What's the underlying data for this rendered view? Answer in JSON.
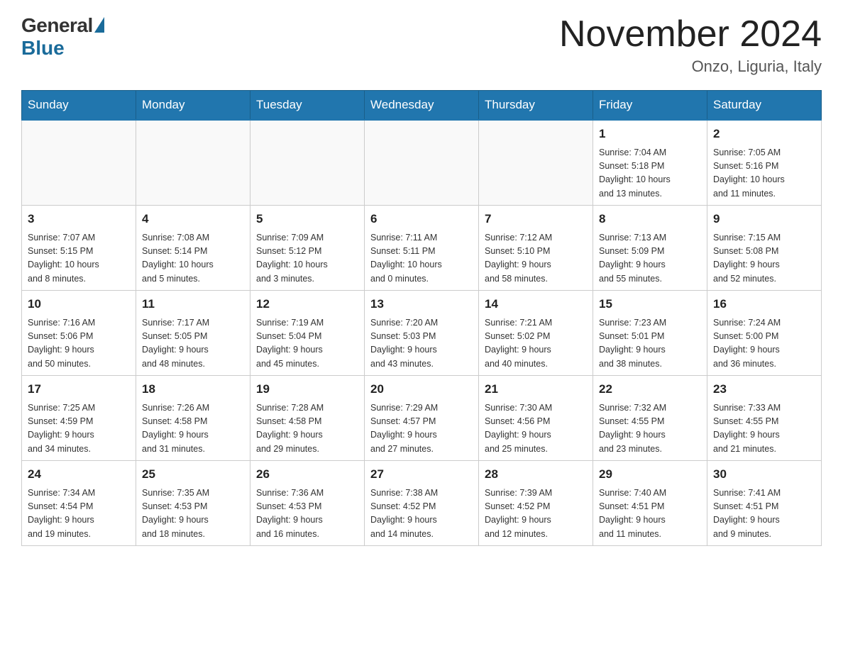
{
  "logo": {
    "general": "General",
    "blue": "Blue"
  },
  "header": {
    "title": "November 2024",
    "location": "Onzo, Liguria, Italy"
  },
  "days_of_week": [
    "Sunday",
    "Monday",
    "Tuesday",
    "Wednesday",
    "Thursday",
    "Friday",
    "Saturday"
  ],
  "weeks": [
    [
      {
        "day": "",
        "info": ""
      },
      {
        "day": "",
        "info": ""
      },
      {
        "day": "",
        "info": ""
      },
      {
        "day": "",
        "info": ""
      },
      {
        "day": "",
        "info": ""
      },
      {
        "day": "1",
        "info": "Sunrise: 7:04 AM\nSunset: 5:18 PM\nDaylight: 10 hours\nand 13 minutes."
      },
      {
        "day": "2",
        "info": "Sunrise: 7:05 AM\nSunset: 5:16 PM\nDaylight: 10 hours\nand 11 minutes."
      }
    ],
    [
      {
        "day": "3",
        "info": "Sunrise: 7:07 AM\nSunset: 5:15 PM\nDaylight: 10 hours\nand 8 minutes."
      },
      {
        "day": "4",
        "info": "Sunrise: 7:08 AM\nSunset: 5:14 PM\nDaylight: 10 hours\nand 5 minutes."
      },
      {
        "day": "5",
        "info": "Sunrise: 7:09 AM\nSunset: 5:12 PM\nDaylight: 10 hours\nand 3 minutes."
      },
      {
        "day": "6",
        "info": "Sunrise: 7:11 AM\nSunset: 5:11 PM\nDaylight: 10 hours\nand 0 minutes."
      },
      {
        "day": "7",
        "info": "Sunrise: 7:12 AM\nSunset: 5:10 PM\nDaylight: 9 hours\nand 58 minutes."
      },
      {
        "day": "8",
        "info": "Sunrise: 7:13 AM\nSunset: 5:09 PM\nDaylight: 9 hours\nand 55 minutes."
      },
      {
        "day": "9",
        "info": "Sunrise: 7:15 AM\nSunset: 5:08 PM\nDaylight: 9 hours\nand 52 minutes."
      }
    ],
    [
      {
        "day": "10",
        "info": "Sunrise: 7:16 AM\nSunset: 5:06 PM\nDaylight: 9 hours\nand 50 minutes."
      },
      {
        "day": "11",
        "info": "Sunrise: 7:17 AM\nSunset: 5:05 PM\nDaylight: 9 hours\nand 48 minutes."
      },
      {
        "day": "12",
        "info": "Sunrise: 7:19 AM\nSunset: 5:04 PM\nDaylight: 9 hours\nand 45 minutes."
      },
      {
        "day": "13",
        "info": "Sunrise: 7:20 AM\nSunset: 5:03 PM\nDaylight: 9 hours\nand 43 minutes."
      },
      {
        "day": "14",
        "info": "Sunrise: 7:21 AM\nSunset: 5:02 PM\nDaylight: 9 hours\nand 40 minutes."
      },
      {
        "day": "15",
        "info": "Sunrise: 7:23 AM\nSunset: 5:01 PM\nDaylight: 9 hours\nand 38 minutes."
      },
      {
        "day": "16",
        "info": "Sunrise: 7:24 AM\nSunset: 5:00 PM\nDaylight: 9 hours\nand 36 minutes."
      }
    ],
    [
      {
        "day": "17",
        "info": "Sunrise: 7:25 AM\nSunset: 4:59 PM\nDaylight: 9 hours\nand 34 minutes."
      },
      {
        "day": "18",
        "info": "Sunrise: 7:26 AM\nSunset: 4:58 PM\nDaylight: 9 hours\nand 31 minutes."
      },
      {
        "day": "19",
        "info": "Sunrise: 7:28 AM\nSunset: 4:58 PM\nDaylight: 9 hours\nand 29 minutes."
      },
      {
        "day": "20",
        "info": "Sunrise: 7:29 AM\nSunset: 4:57 PM\nDaylight: 9 hours\nand 27 minutes."
      },
      {
        "day": "21",
        "info": "Sunrise: 7:30 AM\nSunset: 4:56 PM\nDaylight: 9 hours\nand 25 minutes."
      },
      {
        "day": "22",
        "info": "Sunrise: 7:32 AM\nSunset: 4:55 PM\nDaylight: 9 hours\nand 23 minutes."
      },
      {
        "day": "23",
        "info": "Sunrise: 7:33 AM\nSunset: 4:55 PM\nDaylight: 9 hours\nand 21 minutes."
      }
    ],
    [
      {
        "day": "24",
        "info": "Sunrise: 7:34 AM\nSunset: 4:54 PM\nDaylight: 9 hours\nand 19 minutes."
      },
      {
        "day": "25",
        "info": "Sunrise: 7:35 AM\nSunset: 4:53 PM\nDaylight: 9 hours\nand 18 minutes."
      },
      {
        "day": "26",
        "info": "Sunrise: 7:36 AM\nSunset: 4:53 PM\nDaylight: 9 hours\nand 16 minutes."
      },
      {
        "day": "27",
        "info": "Sunrise: 7:38 AM\nSunset: 4:52 PM\nDaylight: 9 hours\nand 14 minutes."
      },
      {
        "day": "28",
        "info": "Sunrise: 7:39 AM\nSunset: 4:52 PM\nDaylight: 9 hours\nand 12 minutes."
      },
      {
        "day": "29",
        "info": "Sunrise: 7:40 AM\nSunset: 4:51 PM\nDaylight: 9 hours\nand 11 minutes."
      },
      {
        "day": "30",
        "info": "Sunrise: 7:41 AM\nSunset: 4:51 PM\nDaylight: 9 hours\nand 9 minutes."
      }
    ]
  ]
}
